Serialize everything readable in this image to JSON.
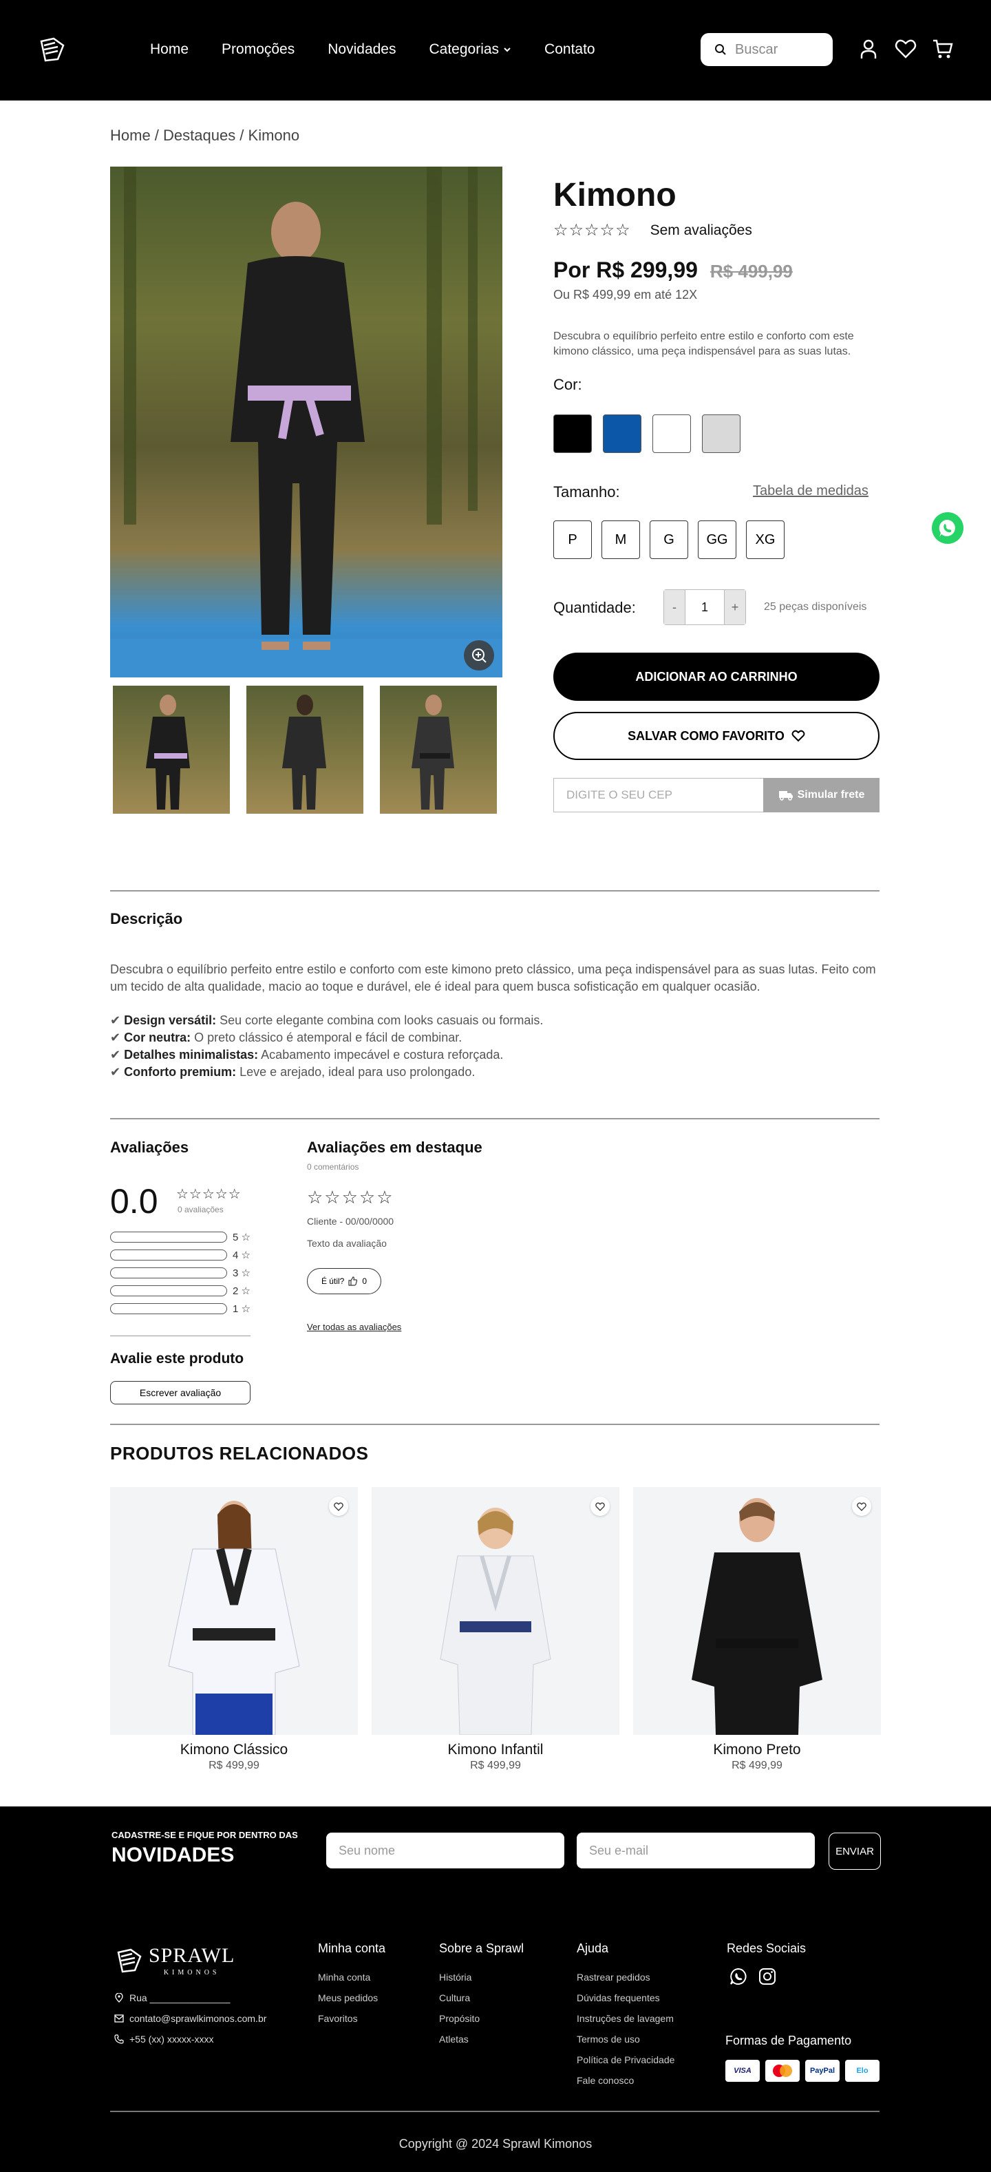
{
  "header": {
    "nav": [
      "Home",
      "Promoções",
      "Novidades",
      "Categorias",
      "Contato"
    ],
    "search_placeholder": "Buscar"
  },
  "breadcrumb": "Home / Destaques / Kimono",
  "product": {
    "title": "Kimono",
    "rating_text": "Sem avaliações",
    "stars": "☆☆☆☆☆",
    "price": "Por R$ 299,99",
    "old_price": "R$ 499,99",
    "installment": "Ou R$ 499,99 em até 12X",
    "short_description": "Descubra o equilíbrio perfeito entre estilo e conforto com este kimono clássico, uma peça indispensável para as suas lutas.",
    "color_label": "Cor:",
    "colors": [
      "#000000",
      "#0d57a8",
      "#ffffff",
      "#d9d9d9"
    ],
    "size_label": "Tamanho:",
    "size_table_link": "Tabela de medidas",
    "sizes": [
      "P",
      "M",
      "G",
      "GG",
      "XG"
    ],
    "quantity_label": "Quantidade:",
    "quantity": "1",
    "qty_minus": "-",
    "qty_plus": "+",
    "stock": "25 peças disponíveis",
    "add_to_cart": "ADICIONAR AO CARRINHO",
    "save_favorite": "SALVAR COMO FAVORITO",
    "cep_placeholder": "DIGITE O SEU CEP",
    "shipping_button": "Simular frete"
  },
  "description": {
    "title": "Descrição",
    "paragraph": "Descubra o equilíbrio perfeito entre estilo e conforto com este kimono preto clássico, uma peça indispensável para as suas lutas. Feito com um tecido de alta qualidade, macio ao toque e durável, ele é ideal para quem busca sofisticação em qualquer ocasião.",
    "features": [
      {
        "label": "Design versátil:",
        "text": " Seu corte elegante combina com looks casuais ou formais."
      },
      {
        "label": "Cor neutra:",
        "text": " O preto clássico é atemporal e fácil de combinar."
      },
      {
        "label": "Detalhes minimalistas:",
        "text": " Acabamento impecável e costura reforçada."
      },
      {
        "label": "Conforto premium:",
        "text": " Leve e arejado, ideal para uso prolongado."
      }
    ]
  },
  "reviews": {
    "title": "Avaliações",
    "average": "0.0",
    "stars": "☆☆☆☆☆",
    "count": "0 avaliações",
    "bars": [
      "5 ☆",
      "4 ☆",
      "3 ☆",
      "2 ☆",
      "1 ☆"
    ],
    "rate_title": "Avalie este produto",
    "write_button": "Escrever avaliação",
    "featured_title": "Avaliações em destaque",
    "comments_count": "0 comentários",
    "client": "Cliente - 00/00/0000",
    "review_text": "Texto da avaliação",
    "useful": "É útil?",
    "useful_count": "0",
    "see_all": "Ver todas as avaliações"
  },
  "related": {
    "title": "PRODUTOS RELACIONADOS",
    "items": [
      {
        "name": "Kimono Clássico",
        "price": "R$ 499,99"
      },
      {
        "name": "Kimono Infantil",
        "price": "R$ 499,99"
      },
      {
        "name": "Kimono Preto",
        "price": "R$ 499,99"
      }
    ]
  },
  "newsletter": {
    "small": "CADASTRE-SE E FIQUE POR DENTRO DAS",
    "big": "NOVIDADES",
    "name_placeholder": "Seu nome",
    "email_placeholder": "Seu e-mail",
    "send": "ENVIAR"
  },
  "footer": {
    "brand": "SPRAWL",
    "brand_sub": "KIMONOS",
    "address": "Rua _______________",
    "email": "contato@sprawlkimonos.com.br",
    "phone": "+55 (xx) xxxxx-xxxx",
    "col1": {
      "title": "Minha conta",
      "items": [
        "Minha conta",
        "Meus pedidos",
        "Favoritos"
      ]
    },
    "col2": {
      "title": "Sobre a Sprawl",
      "items": [
        "História",
        "Cultura",
        "Propósito",
        "Atletas"
      ]
    },
    "col3": {
      "title": "Ajuda",
      "items": [
        "Rastrear pedidos",
        "Dúvidas frequentes",
        "Instruções de lavagem",
        "Termos de uso",
        "Política de Privacidade",
        "Fale conosco"
      ]
    },
    "social_title": "Redes Sociais",
    "payment_title": "Formas de Pagamento",
    "payments": [
      "VISA",
      "Mastercard",
      "PayPal",
      "Elo"
    ],
    "copyright": "Copyright @ 2024 Sprawl Kimonos"
  }
}
